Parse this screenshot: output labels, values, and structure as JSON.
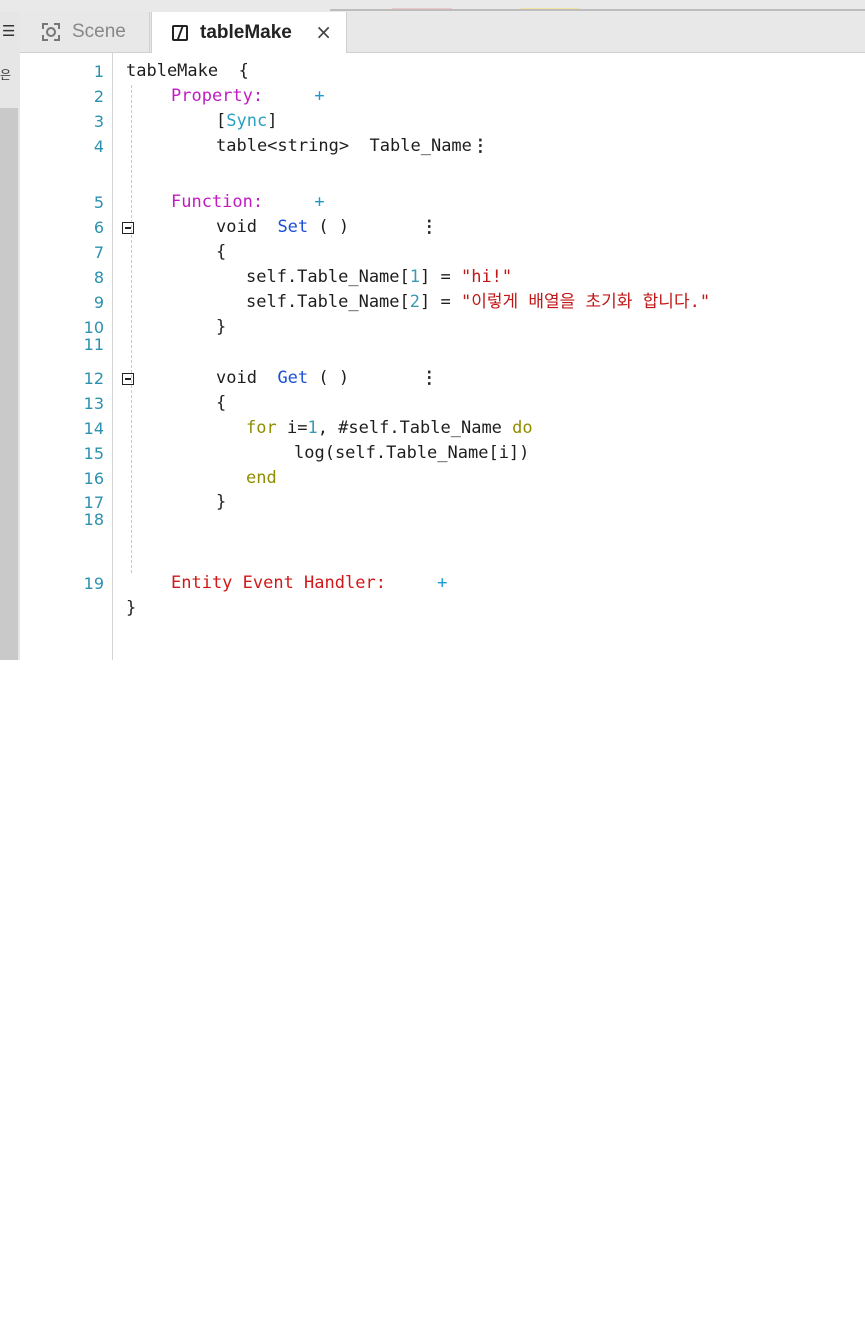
{
  "tabs": [
    {
      "label": "Scene",
      "icon": "scene-icon",
      "active": false
    },
    {
      "label": "tableMake",
      "icon": "script-icon",
      "active": true,
      "close": "×"
    }
  ],
  "left_panel": {
    "menu_glyph": "☰",
    "text": "은"
  },
  "editor": {
    "line_numbers": [
      "1",
      "2",
      "3",
      "4",
      "5",
      "6",
      "7",
      "8",
      "9",
      "10",
      "11",
      "12",
      "13",
      "14",
      "15",
      "16",
      "17",
      "18",
      "19"
    ],
    "header": "tableMake",
    "open_brace": "{",
    "close_brace": "}",
    "property_label": "Property:",
    "plus": "+",
    "sync_attr": "Sync",
    "table_decl": "table<string>",
    "table_name": "Table_Name",
    "function_label": "Function:",
    "void": "void",
    "set_name": "Set",
    "get_name": "Get",
    "parens": "( )",
    "assign_prefix": "self.Table_Name[",
    "idx1": "1",
    "idx2": "2",
    "assign_suffix": "] = ",
    "str1": "\"hi!\"",
    "str2": "\"이렇게 배열을 초기화 합니다.\"",
    "for_kw": "for",
    "for_mid": " i=",
    "for_one": "1",
    "for_rest": ", #self.Table_Name ",
    "do_kw": "do",
    "log_call": "log(self.Table_Name[i])",
    "end_kw": "end",
    "event_handler_label": "Entity Event Handler:"
  },
  "colors": {
    "line_number": "#2b91af",
    "property_keyword": "#c01cc2",
    "function_name": "#1b4fd6",
    "string": "#c01818",
    "loop_keyword": "#8e8e00",
    "event_label": "#d01818"
  }
}
